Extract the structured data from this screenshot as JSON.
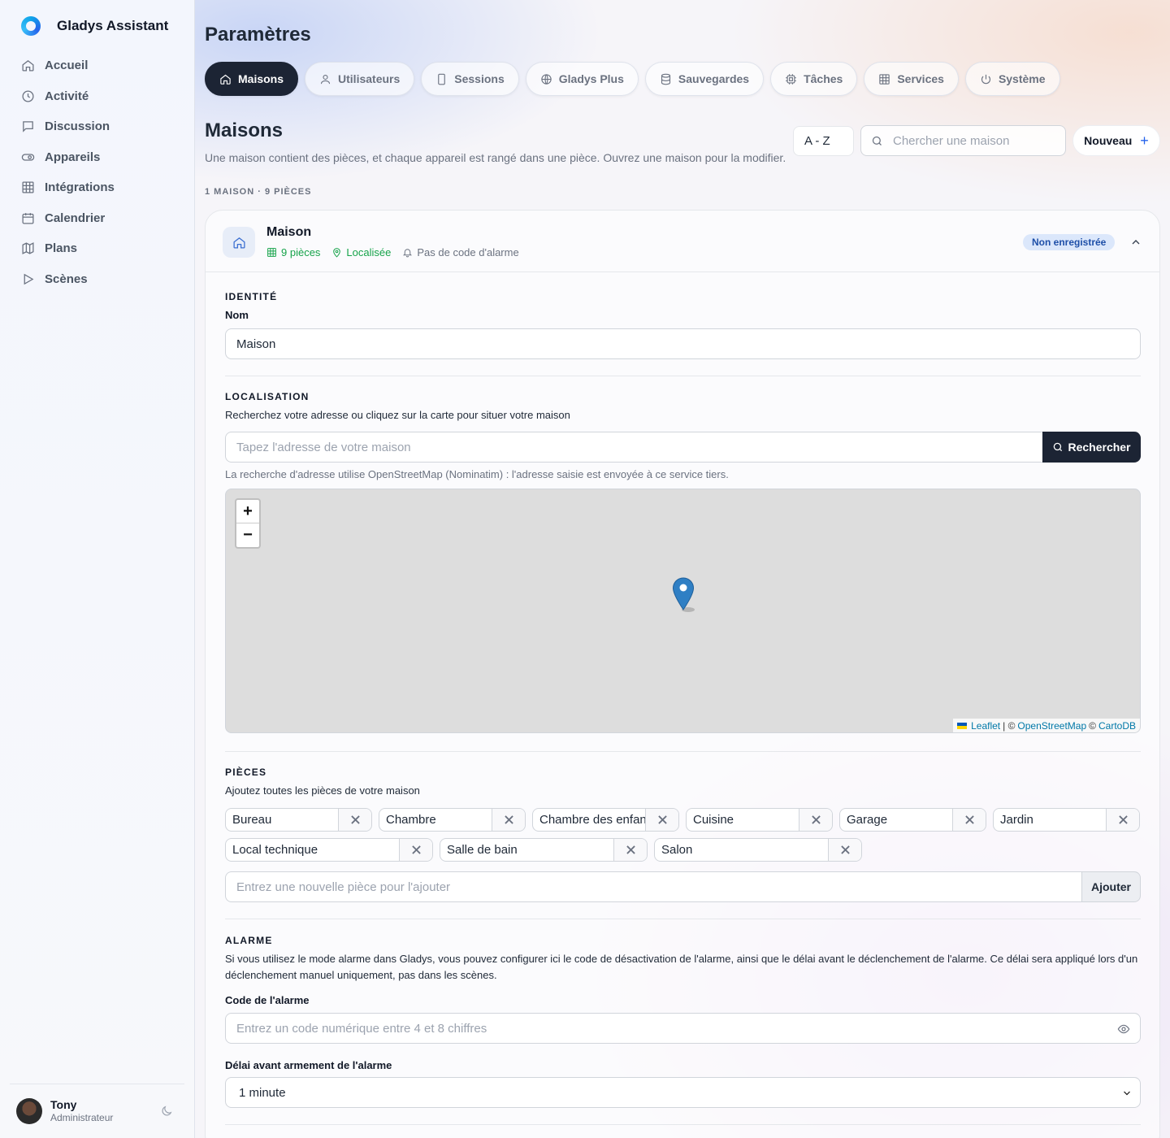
{
  "app": {
    "name": "Gladys Assistant"
  },
  "sidebar": {
    "items": [
      {
        "label": "Accueil",
        "icon": "home-icon"
      },
      {
        "label": "Activité",
        "icon": "clock-icon"
      },
      {
        "label": "Discussion",
        "icon": "chat-icon"
      },
      {
        "label": "Appareils",
        "icon": "toggle-icon"
      },
      {
        "label": "Intégrations",
        "icon": "grid-icon"
      },
      {
        "label": "Calendrier",
        "icon": "calendar-icon"
      },
      {
        "label": "Plans",
        "icon": "map-icon"
      },
      {
        "label": "Scènes",
        "icon": "play-icon"
      }
    ],
    "user": {
      "name": "Tony",
      "role": "Administrateur"
    }
  },
  "header": {
    "title": "Paramètres",
    "tabs": [
      {
        "label": "Maisons",
        "icon": "home-icon",
        "active": true
      },
      {
        "label": "Utilisateurs",
        "icon": "user-icon"
      },
      {
        "label": "Sessions",
        "icon": "phone-icon"
      },
      {
        "label": "Gladys Plus",
        "icon": "globe-icon"
      },
      {
        "label": "Sauvegardes",
        "icon": "database-icon"
      },
      {
        "label": "Tâches",
        "icon": "cpu-icon"
      },
      {
        "label": "Services",
        "icon": "grid-icon"
      },
      {
        "label": "Système",
        "icon": "power-icon"
      }
    ]
  },
  "houses": {
    "title": "Maisons",
    "description": "Une maison contient des pièces, et chaque appareil est rangé dans une pièce. Ouvrez une maison pour la modifier.",
    "sort": "A - Z",
    "search_placeholder": "Chercher une maison",
    "new_label": "Nouveau",
    "counts": "1 MAISON · 9 PIÈCES"
  },
  "house": {
    "name": "Maison",
    "rooms_count": "9 pièces",
    "located": "Localisée",
    "alarm_status": "Pas de code d'alarme",
    "badge": "Non enregistrée",
    "identity": {
      "heading": "IDENTITÉ",
      "name_label": "Nom",
      "name_value": "Maison"
    },
    "location": {
      "heading": "LOCALISATION",
      "help": "Recherchez votre adresse ou cliquez sur la carte pour situer votre maison",
      "address_placeholder": "Tapez l'adresse de votre maison",
      "search_label": "Rechercher",
      "note": "La recherche d'adresse utilise OpenStreetMap (Nominatim) : l'adresse saisie est envoyée à ce service tiers.",
      "attribution": {
        "leaflet": "Leaflet",
        "sep": "| ©",
        "osm": "OpenStreetMap",
        "copy": "©",
        "carto": "CartoDB"
      }
    },
    "rooms": {
      "heading": "PIÈCES",
      "help": "Ajoutez toutes les pièces de votre maison",
      "list": [
        "Bureau",
        "Chambre",
        "Chambre des enfan",
        "Cuisine",
        "Garage",
        "Jardin",
        "Local technique",
        "Salle de bain",
        "Salon"
      ],
      "add_placeholder": "Entrez une nouvelle pièce pour l'ajouter",
      "add_label": "Ajouter"
    },
    "alarm": {
      "heading": "ALARME",
      "help_line1": "Si vous utilisez le mode alarme dans Gladys, vous pouvez configurer ici le code de désactivation de l'alarme, ainsi que le délai avant le déclenchement de l'alarme. Ce délai sera appliqué lors d'un",
      "help_line2": "déclenchement manuel uniquement, pas dans les scènes.",
      "code_label": "Code de l'alarme",
      "code_placeholder": "Entrez un code numérique entre 4 et 8 chiffres",
      "delay_label": "Délai avant armement de l'alarme",
      "delay_value": "1 minute"
    }
  },
  "colors": {
    "accent": "#1c2434",
    "success": "#16a34a",
    "badge_bg": "#dbe7fb",
    "link": "#0078a8"
  }
}
